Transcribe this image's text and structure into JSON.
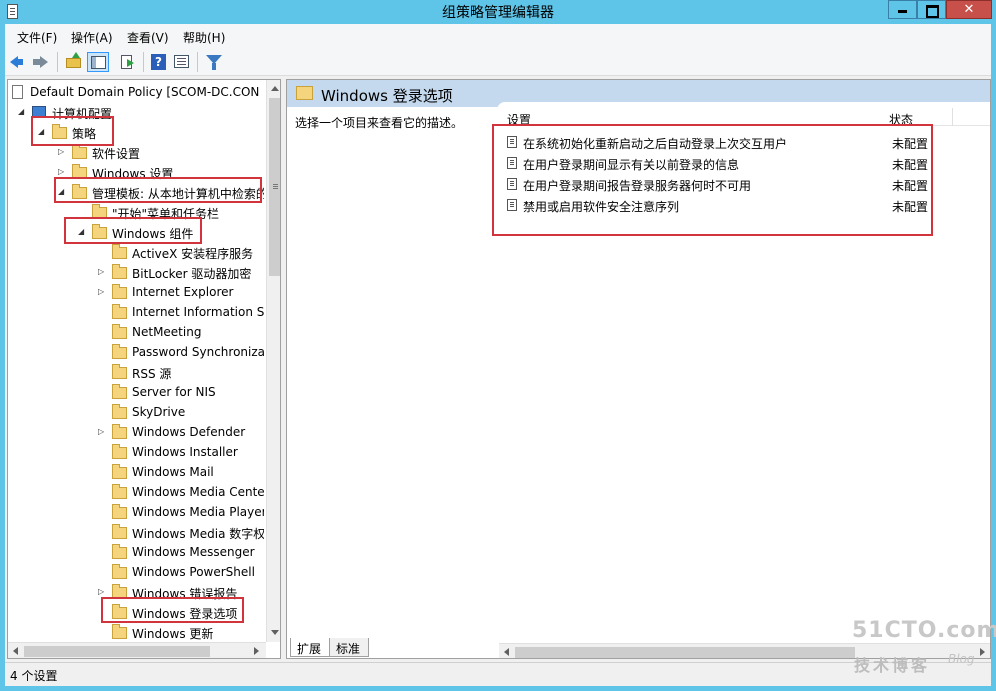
{
  "window": {
    "title": "组策略管理编辑器"
  },
  "menu": {
    "file": "文件(F)",
    "action": "操作(A)",
    "view": "查看(V)",
    "help": "帮助(H)"
  },
  "toolbar": {
    "icons": [
      "back-icon",
      "forward-icon",
      "up-folder-icon",
      "show-hide-tree-icon",
      "export-list-icon",
      "help-icon",
      "properties-icon",
      "filter-icon"
    ]
  },
  "tree": {
    "root": "Default Domain Policy [SCOM-DC.CON",
    "computer_config": "计算机配置",
    "policies": "策略",
    "software_settings": "软件设置",
    "windows_settings": "Windows 设置",
    "admin_templates": "管理模板: 从本地计算机中检索的",
    "start_menu": "\"开始\"菜单和任务栏",
    "windows_components": "Windows 组件",
    "components": [
      "ActiveX 安装程序服务",
      "BitLocker 驱动器加密",
      "Internet Explorer",
      "Internet Information Se",
      "NetMeeting",
      "Password Synchronizat",
      "RSS 源",
      "Server for NIS",
      "SkyDrive",
      "Windows Defender",
      "Windows Installer",
      "Windows Mail",
      "Windows Media Center",
      "Windows Media Player",
      "Windows Media 数字权",
      "Windows Messenger",
      "Windows PowerShell",
      "Windows 错误报告",
      "Windows 登录选项",
      "Windows 更新"
    ]
  },
  "details": {
    "title": "Windows 登录选项",
    "description": "选择一个项目来查看它的描述。",
    "col_setting": "设置",
    "col_state": "状态",
    "items": [
      {
        "name": "在系统初始化重新启动之后自动登录上次交互用户",
        "state": "未配置"
      },
      {
        "name": "在用户登录期间显示有关以前登录的信息",
        "state": "未配置"
      },
      {
        "name": "在用户登录期间报告登录服务器何时不可用",
        "state": "未配置"
      },
      {
        "name": "禁用或启用软件安全注意序列",
        "state": "未配置"
      }
    ]
  },
  "tabs": {
    "extended": "扩展",
    "standard": "标准"
  },
  "status": {
    "text": "4 个设置"
  },
  "watermark": {
    "site": "51CTO.com",
    "blog_cn": "技术博客",
    "blog_en": "Blog"
  },
  "colors": {
    "titlebar": "#5ec4e8",
    "highlight": "#d1343d",
    "header": "#c4d9ee"
  }
}
